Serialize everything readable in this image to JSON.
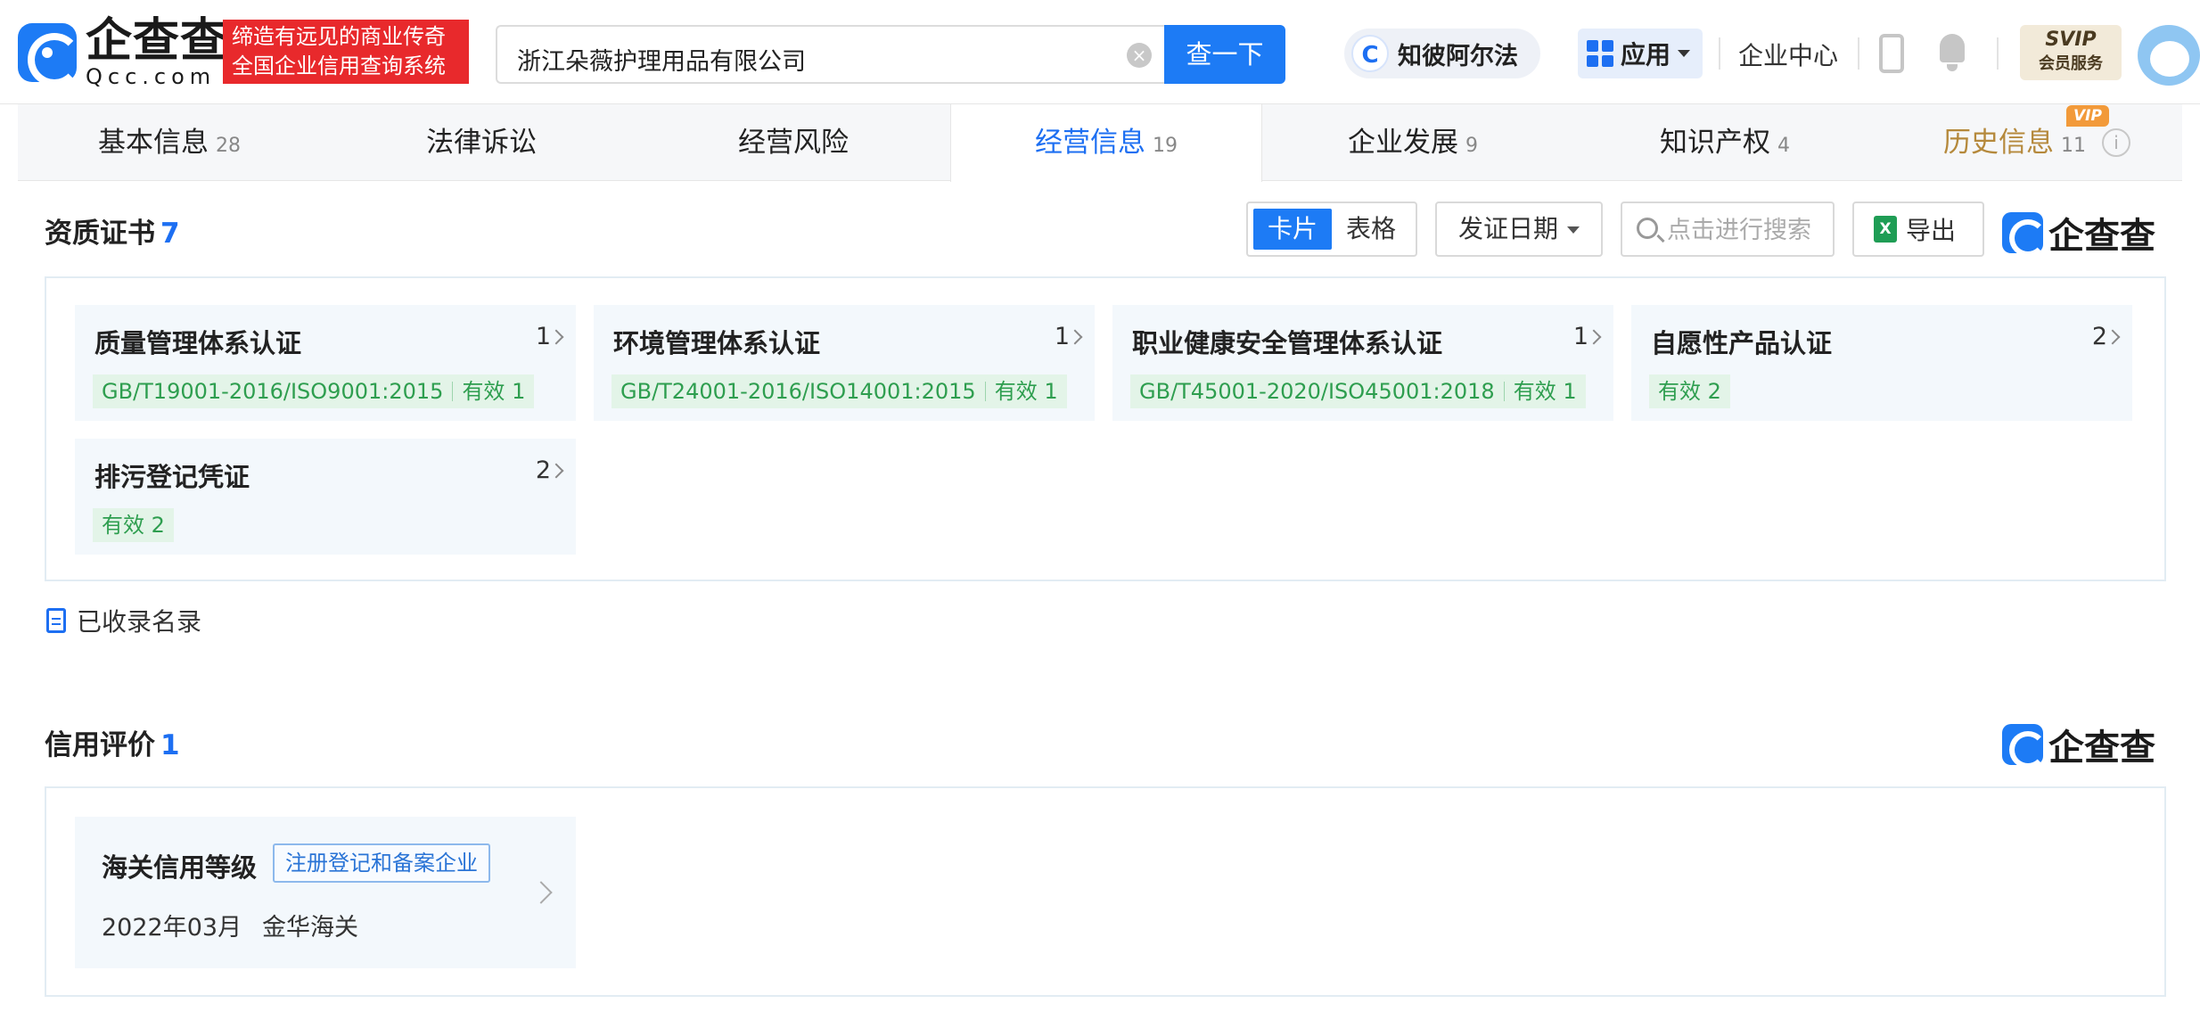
{
  "header": {
    "logo_text": "企查查",
    "logo_domain": "Qcc.com",
    "slogan_line1": "缔造有远见的商业传奇",
    "slogan_line2": "全国企业信用查询系统",
    "search_value": "浙江朵薇护理用品有限公司",
    "search_button": "查一下",
    "zhibi_label": "知彼阿尔法",
    "app_label": "应用",
    "enterprise_center": "企业中心",
    "svip_label": "SVIP",
    "member_service": "会员服务"
  },
  "tabs": [
    {
      "label": "基本信息",
      "count": "28"
    },
    {
      "label": "法律诉讼",
      "count": ""
    },
    {
      "label": "经营风险",
      "count": ""
    },
    {
      "label": "经营信息",
      "count": "19"
    },
    {
      "label": "企业发展",
      "count": "9"
    },
    {
      "label": "知识产权",
      "count": "4"
    },
    {
      "label": "历史信息",
      "count": "11"
    }
  ],
  "vip_badge": "VIP",
  "certificates": {
    "title": "资质证书",
    "count": "7",
    "view_card": "卡片",
    "view_table": "表格",
    "sort_label": "发证日期",
    "search_placeholder": "点击进行搜索",
    "export_label": "导出",
    "watermark": "企查查",
    "cards": [
      {
        "title": "质量管理体系认证",
        "count": "1",
        "standard": "GB/T19001-2016/ISO9001:2015",
        "status": "有效 1"
      },
      {
        "title": "环境管理体系认证",
        "count": "1",
        "standard": "GB/T24001-2016/ISO14001:2015",
        "status": "有效 1"
      },
      {
        "title": "职业健康安全管理体系认证",
        "count": "1",
        "standard": "GB/T45001-2020/ISO45001:2018",
        "status": "有效 1"
      },
      {
        "title": "自愿性产品认证",
        "count": "2",
        "standard": "",
        "status": "有效 2"
      },
      {
        "title": "排污登记凭证",
        "count": "2",
        "standard": "",
        "status": "有效 2"
      }
    ],
    "recorded_list": "已收录名录"
  },
  "credit": {
    "title": "信用评价",
    "count": "1",
    "watermark": "企查查",
    "card": {
      "title": "海关信用等级",
      "tag": "注册登记和备案企业",
      "date": "2022年03月",
      "org": "金华海关"
    }
  },
  "colors": {
    "brand_blue": "#1d7bf5",
    "slogan_red": "#e8292c",
    "valid_green": "#2e9e4f",
    "history_gold": "#b5893c"
  }
}
